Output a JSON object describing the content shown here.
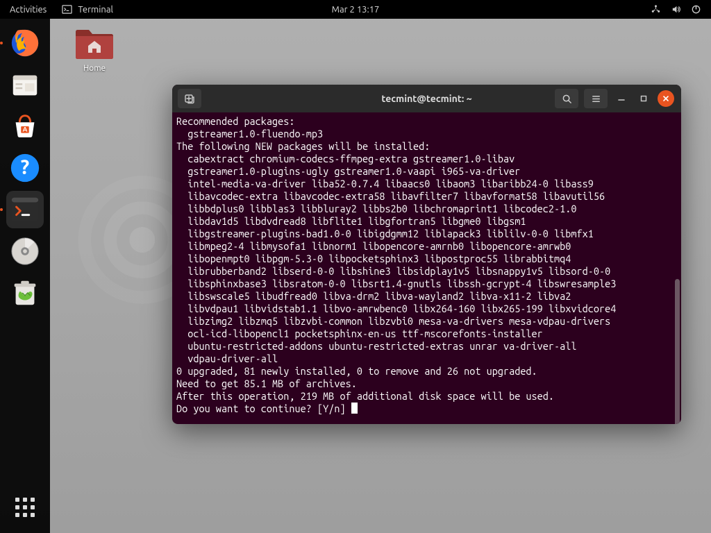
{
  "topbar": {
    "activities": "Activities",
    "app_label": "Terminal",
    "clock": "Mar 2  13:17"
  },
  "dock": {
    "items": [
      {
        "name": "firefox"
      },
      {
        "name": "files"
      },
      {
        "name": "software"
      },
      {
        "name": "help"
      },
      {
        "name": "terminal"
      },
      {
        "name": "disk"
      },
      {
        "name": "trash"
      }
    ]
  },
  "desktop": {
    "home_label": "Home"
  },
  "terminal": {
    "title": "tecmint@tecmint: ~",
    "lines": [
      "Recommended packages:",
      "  gstreamer1.0-fluendo-mp3",
      "The following NEW packages will be installed:",
      "  cabextract chromium-codecs-ffmpeg-extra gstreamer1.0-libav",
      "  gstreamer1.0-plugins-ugly gstreamer1.0-vaapi i965-va-driver",
      "  intel-media-va-driver liba52-0.7.4 libaacs0 libaom3 libaribb24-0 libass9",
      "  libavcodec-extra libavcodec-extra58 libavfilter7 libavformat58 libavutil56",
      "  libbdplus0 libblas3 libbluray2 libbs2b0 libchromaprint1 libcodec2-1.0",
      "  libdav1d5 libdvdread8 libflite1 libgfortran5 libgme0 libgsm1",
      "  libgstreamer-plugins-bad1.0-0 libigdgmm12 liblapack3 liblilv-0-0 libmfx1",
      "  libmpeg2-4 libmysofa1 libnorm1 libopencore-amrnb0 libopencore-amrwb0",
      "  libopenmpt0 libpgm-5.3-0 libpocketsphinx3 libpostproc55 librabbitmq4",
      "  librubberband2 libserd-0-0 libshine3 libsidplay1v5 libsnappy1v5 libsord-0-0",
      "  libsphinxbase3 libsratom-0-0 libsrt1.4-gnutls libssh-gcrypt-4 libswresample3",
      "  libswscale5 libudfread0 libva-drm2 libva-wayland2 libva-x11-2 libva2",
      "  libvdpau1 libvidstab1.1 libvo-amrwbenc0 libx264-160 libx265-199 libxvidcore4",
      "  libzimg2 libzmq5 libzvbi-common libzvbi0 mesa-va-drivers mesa-vdpau-drivers",
      "  ocl-icd-libopencl1 pocketsphinx-en-us ttf-mscorefonts-installer",
      "  ubuntu-restricted-addons ubuntu-restricted-extras unrar va-driver-all",
      "  vdpau-driver-all",
      "0 upgraded, 81 newly installed, 0 to remove and 26 not upgraded.",
      "Need to get 85.1 MB of archives.",
      "After this operation, 219 MB of additional disk space will be used.",
      "Do you want to continue? [Y/n] "
    ]
  }
}
